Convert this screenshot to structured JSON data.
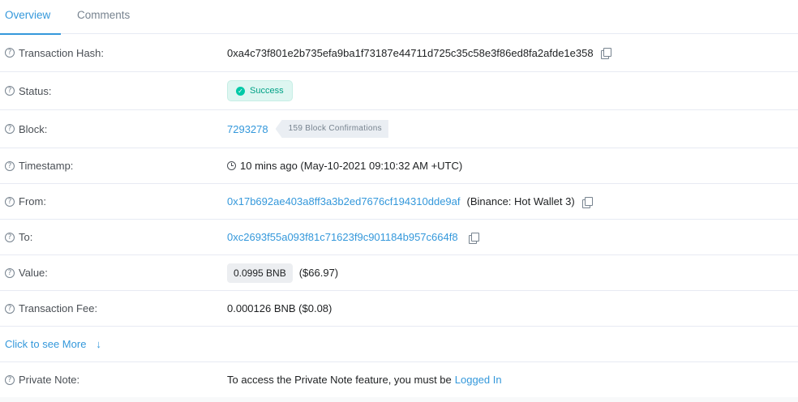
{
  "tabs": {
    "overview": "Overview",
    "comments": "Comments"
  },
  "rows": {
    "hash": {
      "label": "Transaction Hash:",
      "value": "0xa4c73f801e2b735efa9ba1f73187e44711d725c35c58e3f86ed8fa2afde1e358"
    },
    "status": {
      "label": "Status:",
      "value": "Success"
    },
    "block": {
      "label": "Block:",
      "value": "7293278",
      "confirmations": "159 Block Confirmations"
    },
    "timestamp": {
      "label": "Timestamp:",
      "value": "10 mins ago (May-10-2021 09:10:32 AM +UTC)"
    },
    "from": {
      "label": "From:",
      "address": "0x17b692ae403a8ff3a3b2ed7676cf194310dde9af",
      "name": "(Binance: Hot Wallet 3)"
    },
    "to": {
      "label": "To:",
      "address": "0xc2693f55a093f81c71623f9c901184b957c664f8"
    },
    "value": {
      "label": "Value:",
      "amount": "0.0995 BNB",
      "usd": "($66.97)"
    },
    "fee": {
      "label": "Transaction Fee:",
      "value": "0.000126 BNB ($0.08)"
    },
    "more": {
      "label": "Click to see More"
    },
    "note": {
      "label": "Private Note:",
      "text": "To access the Private Note feature, you must be",
      "link": "Logged In"
    }
  },
  "colors": {
    "accent": "#3498db",
    "success": "#00c9a7",
    "muted": "#77838f"
  }
}
